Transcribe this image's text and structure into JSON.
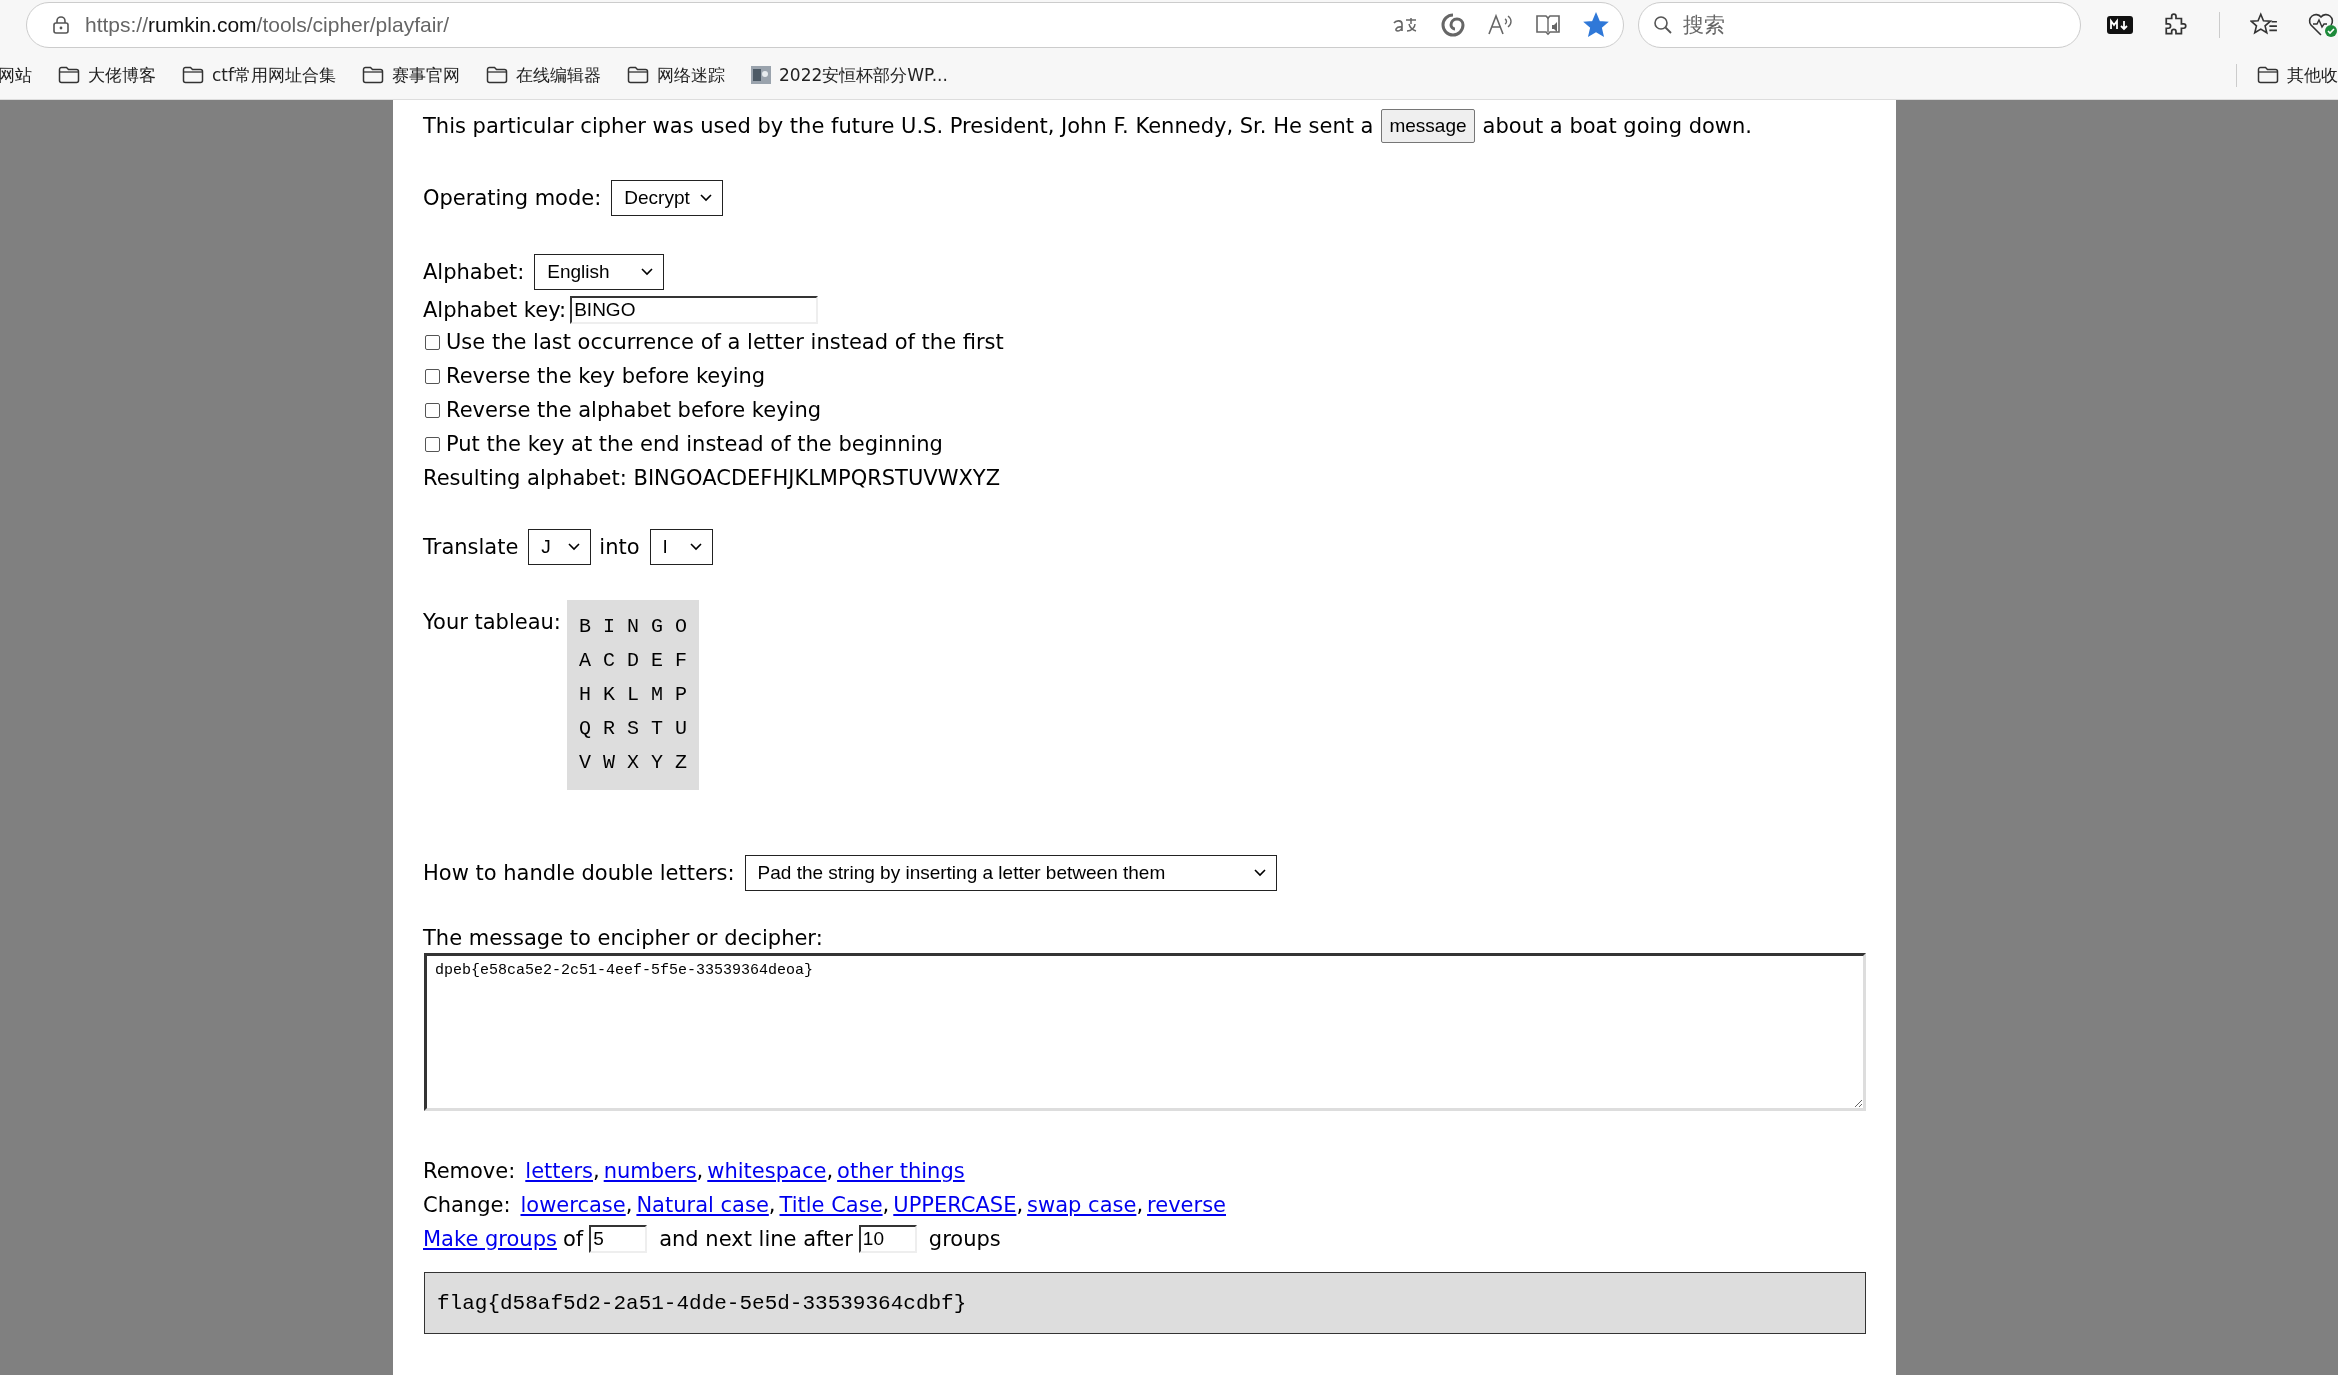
{
  "browser": {
    "url": {
      "scheme": "https://",
      "host": "rumkin.com",
      "path": "/tools/cipher/playfair/"
    },
    "favorite": true,
    "search": {
      "placeholder": "搜索"
    },
    "bookmarks": [
      {
        "label": "网站",
        "kind": "none"
      },
      {
        "label": "大佬博客",
        "kind": "folder"
      },
      {
        "label": "ctf常用网址合集",
        "kind": "folder"
      },
      {
        "label": "赛事官网",
        "kind": "folder"
      },
      {
        "label": "在线编辑器",
        "kind": "folder"
      },
      {
        "label": "网络迷踪",
        "kind": "folder"
      },
      {
        "label": "2022安恒杯部分WP...",
        "kind": "page"
      }
    ],
    "other_bookmarks": "其他收"
  },
  "page": {
    "intro": {
      "before": "This particular cipher was used by the future U.S. President, John F. Kennedy, Sr. He sent a",
      "button": "message",
      "after": "about a boat going down."
    },
    "operating_mode": {
      "label": "Operating mode:",
      "value": "Decrypt"
    },
    "alphabet": {
      "label": "Alphabet:",
      "value": "English"
    },
    "alphabet_key": {
      "label": "Alphabet key:",
      "value": "BINGO"
    },
    "options": [
      {
        "label": "Use the last occurrence of a letter instead of the first",
        "checked": false
      },
      {
        "label": "Reverse the key before keying",
        "checked": false
      },
      {
        "label": "Reverse the alphabet before keying",
        "checked": false
      },
      {
        "label": "Put the key at the end instead of the beginning",
        "checked": false
      }
    ],
    "resulting_alphabet": "Resulting alphabet: BINGOACDEFHJKLMPQRSTUVWXYZ",
    "translate": {
      "label": "Translate",
      "from": "J",
      "into_label": "into",
      "to": "I"
    },
    "tableau": {
      "label": "Your tableau:",
      "rows": [
        "B I N G O",
        "A C D E F",
        "H K L M P",
        "Q R S T U",
        "V W X Y Z"
      ]
    },
    "double_letters": {
      "label": "How to handle double letters:",
      "value": "Pad the string by inserting a letter between them"
    },
    "message": {
      "label": "The message to encipher or decipher:",
      "value": "dpeb{e58ca5e2-2c51-4eef-5f5e-33539364deoa}"
    },
    "remove": {
      "label": "Remove:",
      "links": [
        {
          "text": "letters",
          "sep": ","
        },
        {
          "text": "numbers",
          "sep": ","
        },
        {
          "text": "whitespace",
          "sep": ","
        },
        {
          "text": "other things"
        }
      ]
    },
    "change": {
      "label": "Change:",
      "links": [
        {
          "text": "lowercase",
          "sep": ","
        },
        {
          "text": "Natural case",
          "sep": ","
        },
        {
          "text": "Title Case",
          "sep": ","
        },
        {
          "text": "UPPERCASE",
          "sep": ","
        },
        {
          "text": "swap case",
          "sep": ","
        },
        {
          "text": "reverse"
        }
      ]
    },
    "groups": {
      "link": "Make groups",
      "of": "of",
      "size": "5",
      "next": "and next line after",
      "count": "10",
      "suffix": "groups"
    },
    "result": "flag{d58af5d2-2a51-4dde-5e5d-33539364cdbf}"
  }
}
